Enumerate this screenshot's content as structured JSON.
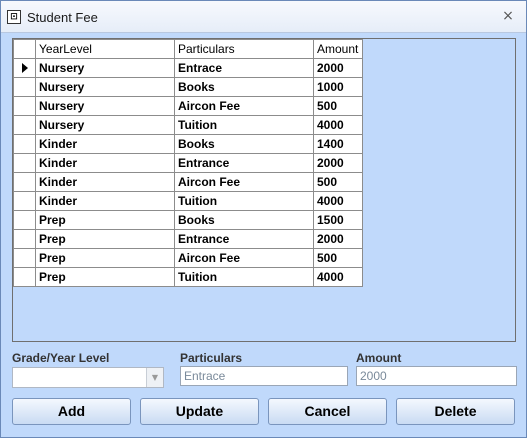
{
  "window": {
    "title": "Student Fee",
    "icon": "app-window-icon",
    "close_label": "×"
  },
  "grid": {
    "columns": [
      "YearLevel",
      "Particulars",
      "Amount"
    ],
    "rows": [
      {
        "year_level": "Nursery",
        "particulars": "Entrace",
        "amount": "2000",
        "current": true
      },
      {
        "year_level": "Nursery",
        "particulars": "Books",
        "amount": "1000",
        "current": false
      },
      {
        "year_level": "Nursery",
        "particulars": "Aircon Fee",
        "amount": "500",
        "current": false
      },
      {
        "year_level": "Nursery",
        "particulars": "Tuition",
        "amount": "4000",
        "current": false
      },
      {
        "year_level": "Kinder",
        "particulars": "Books",
        "amount": "1400",
        "current": false
      },
      {
        "year_level": "Kinder",
        "particulars": "Entrance",
        "amount": "2000",
        "current": false
      },
      {
        "year_level": "Kinder",
        "particulars": "Aircon Fee",
        "amount": "500",
        "current": false
      },
      {
        "year_level": "Kinder",
        "particulars": "Tuition",
        "amount": "4000",
        "current": false
      },
      {
        "year_level": "Prep",
        "particulars": "Books",
        "amount": "1500",
        "current": false
      },
      {
        "year_level": "Prep",
        "particulars": "Entrance",
        "amount": "2000",
        "current": false
      },
      {
        "year_level": "Prep",
        "particulars": "Aircon Fee",
        "amount": "500",
        "current": false
      },
      {
        "year_level": "Prep",
        "particulars": "Tuition",
        "amount": "4000",
        "current": false
      }
    ]
  },
  "form": {
    "grade_label": "Grade/Year Level",
    "grade_value": "",
    "particulars_label": "Particulars",
    "particulars_value": "Entrace",
    "amount_label": "Amount",
    "amount_value": "2000"
  },
  "buttons": {
    "add": "Add",
    "update": "Update",
    "cancel": "Cancel",
    "delete": "Delete"
  },
  "colors": {
    "window_bg": "#c0d9fb",
    "grid_bg": "#ffffff"
  }
}
